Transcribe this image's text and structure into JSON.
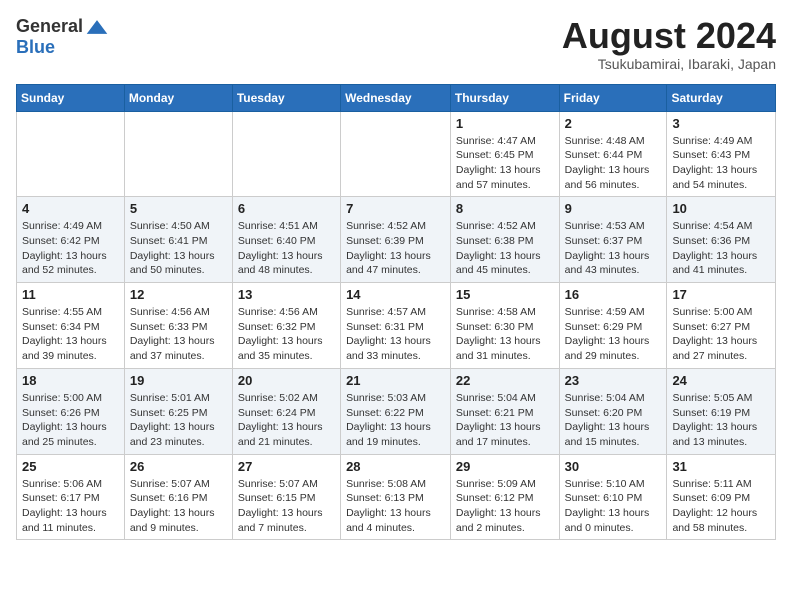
{
  "logo": {
    "general": "General",
    "blue": "Blue"
  },
  "title": {
    "month_year": "August 2024",
    "location": "Tsukubamirai, Ibaraki, Japan"
  },
  "days_of_week": [
    "Sunday",
    "Monday",
    "Tuesday",
    "Wednesday",
    "Thursday",
    "Friday",
    "Saturday"
  ],
  "weeks": [
    [
      {
        "day": "",
        "info": ""
      },
      {
        "day": "",
        "info": ""
      },
      {
        "day": "",
        "info": ""
      },
      {
        "day": "",
        "info": ""
      },
      {
        "day": "1",
        "info": "Sunrise: 4:47 AM\nSunset: 6:45 PM\nDaylight: 13 hours\nand 57 minutes."
      },
      {
        "day": "2",
        "info": "Sunrise: 4:48 AM\nSunset: 6:44 PM\nDaylight: 13 hours\nand 56 minutes."
      },
      {
        "day": "3",
        "info": "Sunrise: 4:49 AM\nSunset: 6:43 PM\nDaylight: 13 hours\nand 54 minutes."
      }
    ],
    [
      {
        "day": "4",
        "info": "Sunrise: 4:49 AM\nSunset: 6:42 PM\nDaylight: 13 hours\nand 52 minutes."
      },
      {
        "day": "5",
        "info": "Sunrise: 4:50 AM\nSunset: 6:41 PM\nDaylight: 13 hours\nand 50 minutes."
      },
      {
        "day": "6",
        "info": "Sunrise: 4:51 AM\nSunset: 6:40 PM\nDaylight: 13 hours\nand 48 minutes."
      },
      {
        "day": "7",
        "info": "Sunrise: 4:52 AM\nSunset: 6:39 PM\nDaylight: 13 hours\nand 47 minutes."
      },
      {
        "day": "8",
        "info": "Sunrise: 4:52 AM\nSunset: 6:38 PM\nDaylight: 13 hours\nand 45 minutes."
      },
      {
        "day": "9",
        "info": "Sunrise: 4:53 AM\nSunset: 6:37 PM\nDaylight: 13 hours\nand 43 minutes."
      },
      {
        "day": "10",
        "info": "Sunrise: 4:54 AM\nSunset: 6:36 PM\nDaylight: 13 hours\nand 41 minutes."
      }
    ],
    [
      {
        "day": "11",
        "info": "Sunrise: 4:55 AM\nSunset: 6:34 PM\nDaylight: 13 hours\nand 39 minutes."
      },
      {
        "day": "12",
        "info": "Sunrise: 4:56 AM\nSunset: 6:33 PM\nDaylight: 13 hours\nand 37 minutes."
      },
      {
        "day": "13",
        "info": "Sunrise: 4:56 AM\nSunset: 6:32 PM\nDaylight: 13 hours\nand 35 minutes."
      },
      {
        "day": "14",
        "info": "Sunrise: 4:57 AM\nSunset: 6:31 PM\nDaylight: 13 hours\nand 33 minutes."
      },
      {
        "day": "15",
        "info": "Sunrise: 4:58 AM\nSunset: 6:30 PM\nDaylight: 13 hours\nand 31 minutes."
      },
      {
        "day": "16",
        "info": "Sunrise: 4:59 AM\nSunset: 6:29 PM\nDaylight: 13 hours\nand 29 minutes."
      },
      {
        "day": "17",
        "info": "Sunrise: 5:00 AM\nSunset: 6:27 PM\nDaylight: 13 hours\nand 27 minutes."
      }
    ],
    [
      {
        "day": "18",
        "info": "Sunrise: 5:00 AM\nSunset: 6:26 PM\nDaylight: 13 hours\nand 25 minutes."
      },
      {
        "day": "19",
        "info": "Sunrise: 5:01 AM\nSunset: 6:25 PM\nDaylight: 13 hours\nand 23 minutes."
      },
      {
        "day": "20",
        "info": "Sunrise: 5:02 AM\nSunset: 6:24 PM\nDaylight: 13 hours\nand 21 minutes."
      },
      {
        "day": "21",
        "info": "Sunrise: 5:03 AM\nSunset: 6:22 PM\nDaylight: 13 hours\nand 19 minutes."
      },
      {
        "day": "22",
        "info": "Sunrise: 5:04 AM\nSunset: 6:21 PM\nDaylight: 13 hours\nand 17 minutes."
      },
      {
        "day": "23",
        "info": "Sunrise: 5:04 AM\nSunset: 6:20 PM\nDaylight: 13 hours\nand 15 minutes."
      },
      {
        "day": "24",
        "info": "Sunrise: 5:05 AM\nSunset: 6:19 PM\nDaylight: 13 hours\nand 13 minutes."
      }
    ],
    [
      {
        "day": "25",
        "info": "Sunrise: 5:06 AM\nSunset: 6:17 PM\nDaylight: 13 hours\nand 11 minutes."
      },
      {
        "day": "26",
        "info": "Sunrise: 5:07 AM\nSunset: 6:16 PM\nDaylight: 13 hours\nand 9 minutes."
      },
      {
        "day": "27",
        "info": "Sunrise: 5:07 AM\nSunset: 6:15 PM\nDaylight: 13 hours\nand 7 minutes."
      },
      {
        "day": "28",
        "info": "Sunrise: 5:08 AM\nSunset: 6:13 PM\nDaylight: 13 hours\nand 4 minutes."
      },
      {
        "day": "29",
        "info": "Sunrise: 5:09 AM\nSunset: 6:12 PM\nDaylight: 13 hours\nand 2 minutes."
      },
      {
        "day": "30",
        "info": "Sunrise: 5:10 AM\nSunset: 6:10 PM\nDaylight: 13 hours\nand 0 minutes."
      },
      {
        "day": "31",
        "info": "Sunrise: 5:11 AM\nSunset: 6:09 PM\nDaylight: 12 hours\nand 58 minutes."
      }
    ]
  ]
}
